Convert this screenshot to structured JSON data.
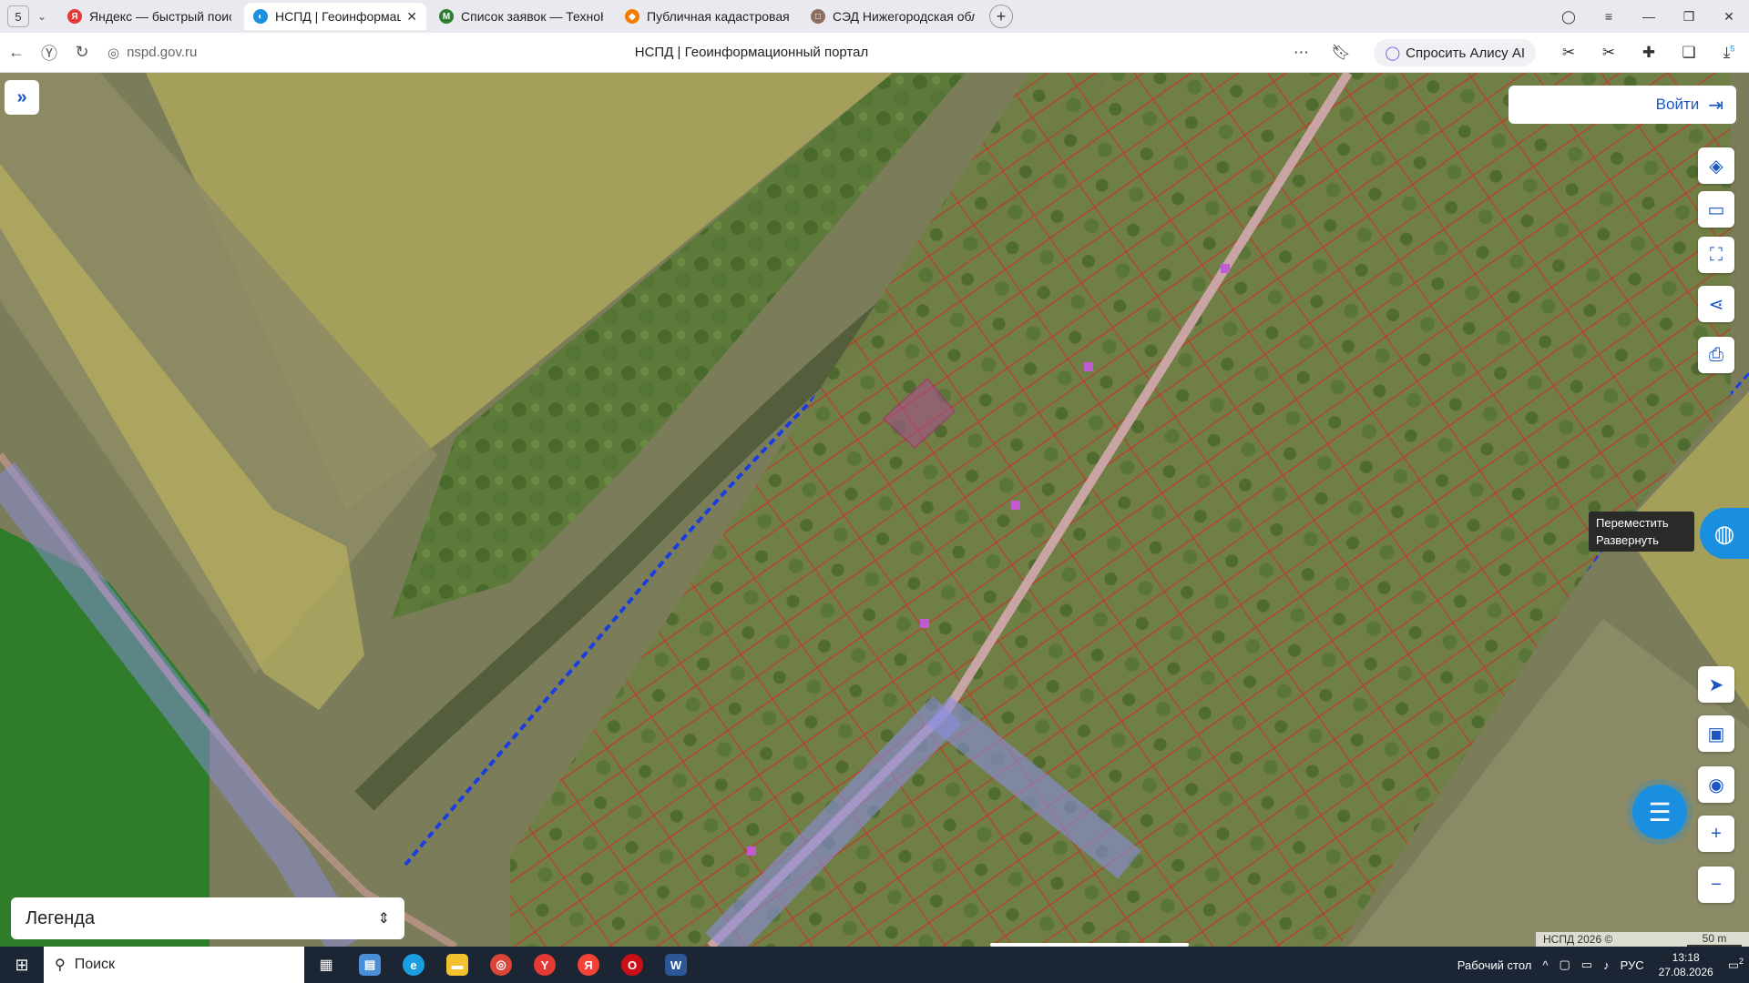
{
  "browser": {
    "tab_count": "5",
    "tabs": [
      {
        "title": "Яндекс — быстрый поиск",
        "fav_color": "#e53935",
        "fav_glyph": "Я"
      },
      {
        "title": "НСПД | Геоинформаци",
        "fav_color": "#1a8fe0",
        "fav_glyph": "◐"
      },
      {
        "title": "Список заявок — ТехноК",
        "fav_color": "#2e7d32",
        "fav_glyph": "M"
      },
      {
        "title": "Публичная кадастровая",
        "fav_color": "#f57c00",
        "fav_glyph": "◆"
      },
      {
        "title": "СЭД Нижегородская обл",
        "fav_color": "#8d6e63",
        "fav_glyph": "□"
      }
    ],
    "url": "nspd.gov.ru",
    "page_title": "НСПД | Геоинформационный портал",
    "alice_label": "Спросить Алису AI",
    "downloads_badge": "5"
  },
  "map": {
    "login_label": "Войти",
    "tooltip_line1": "Переместить",
    "tooltip_line2": "Развернуть",
    "legend_label": "Легенда",
    "copyright": "НСПД 2026 ©",
    "scale_label": "50 m"
  },
  "taskbar": {
    "search_placeholder": "Поиск",
    "desktop_label": "Рабочий стол",
    "lang": "РУС",
    "time": "13:18",
    "date": "27.08.2026",
    "notif_count": "2"
  }
}
